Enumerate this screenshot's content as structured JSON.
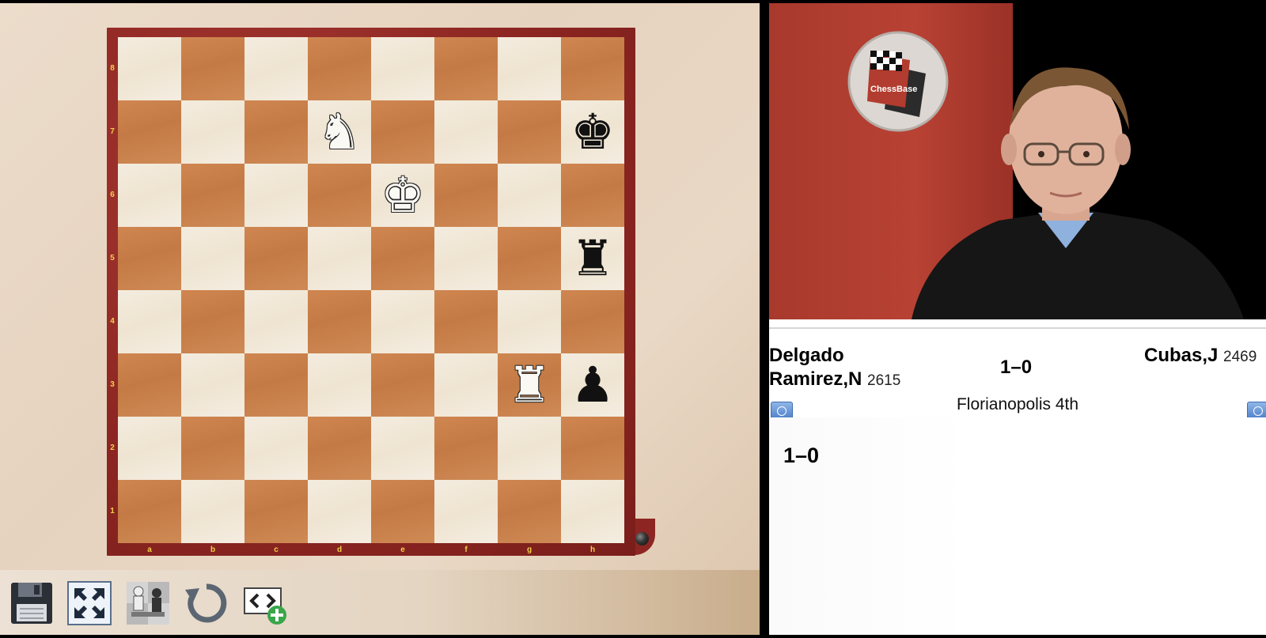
{
  "board": {
    "ranks": [
      "8",
      "7",
      "6",
      "5",
      "4",
      "3",
      "2",
      "1"
    ],
    "files": [
      "a",
      "b",
      "c",
      "d",
      "e",
      "f",
      "g",
      "h"
    ],
    "pieces": [
      {
        "square": "d7",
        "glyph": "♞",
        "color": "white",
        "name": "white-knight"
      },
      {
        "square": "h7",
        "glyph": "♚",
        "color": "black",
        "name": "black-king"
      },
      {
        "square": "e6",
        "glyph": "♚",
        "color": "white",
        "name": "white-king"
      },
      {
        "square": "h5",
        "glyph": "♜",
        "color": "black",
        "name": "black-rook"
      },
      {
        "square": "g3",
        "glyph": "♜",
        "color": "white",
        "name": "white-rook"
      },
      {
        "square": "h3",
        "glyph": "♟",
        "color": "black",
        "name": "black-pawn"
      }
    ]
  },
  "toolbar": {
    "icons": [
      "save-icon",
      "fullscreen-icon",
      "flip-board-icon",
      "rotate-icon",
      "embed-add-icon"
    ]
  },
  "game": {
    "white_name_line1": "Delgado",
    "white_name_line2": "Ramirez,N",
    "white_elo": "2615",
    "black_name": "Cubas,J",
    "black_elo": "2469",
    "result": "1–0",
    "event": "Florianopolis 4th",
    "notation_result": "1–0"
  },
  "video": {
    "logo_text": "ChessBase"
  },
  "colors": {
    "light_square": "#efe4d1",
    "dark_square": "#c47a45",
    "frame": "#8d2622",
    "coord_label": "#f2d24a"
  }
}
